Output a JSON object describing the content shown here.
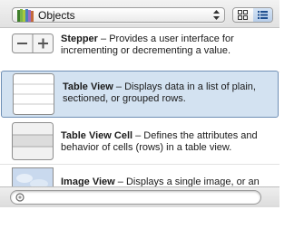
{
  "library": {
    "selected": "Objects",
    "icon": "books-icon"
  },
  "view_toggle": {
    "icons": [
      "icon-grid-icon",
      "list-view-icon"
    ],
    "active": "list-view-icon"
  },
  "items": [
    {
      "icon": "stepper-icon",
      "name": "Stepper",
      "desc": " – Provides a user interface for incrementing or decrementing a value."
    },
    {
      "icon": "table-view-icon",
      "name": "Table View",
      "desc": " – Displays data in a list of plain, sectioned, or grouped rows."
    },
    {
      "icon": "table-view-cell-icon",
      "name": "Table View Cell",
      "desc": " – Defines the attributes and behavior of cells (rows) in a table view."
    },
    {
      "icon": "image-view-icon",
      "name": "Image View",
      "desc": " – Displays a single image, or an"
    }
  ],
  "filter": {
    "value": "",
    "placeholder": ""
  },
  "colors": {
    "selection": "#d3e2f1",
    "selection_border": "#6f8fb5",
    "toolbar": "#e8e8e8"
  }
}
